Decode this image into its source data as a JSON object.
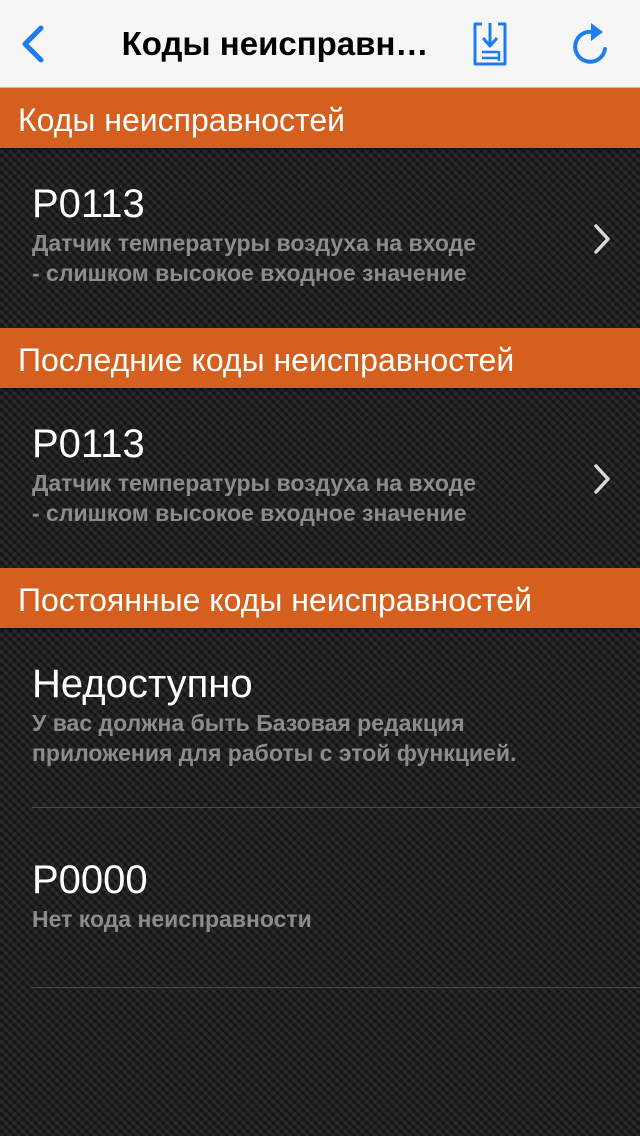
{
  "navbar": {
    "title": "Коды неисправн…",
    "back_icon": "chevron-left-icon",
    "export_icon": "export-document-icon",
    "refresh_icon": "refresh-icon",
    "accent_color": "#1e7cf2"
  },
  "theme": {
    "section_color": "#d45f1e",
    "code_color": "#ffffff",
    "desc_color": "#8c8c8c"
  },
  "sections": [
    {
      "title": "Коды неисправностей",
      "rows": [
        {
          "code": "P0113",
          "desc_line1": "Датчик температуры воздуха на входе",
          "desc_line2": "- слишком высокое входное значение",
          "has_chevron": true
        }
      ]
    },
    {
      "title": "Последние коды неисправностей",
      "rows": [
        {
          "code": "P0113",
          "desc_line1": "Датчик температуры воздуха на входе",
          "desc_line2": "- слишком высокое входное значение",
          "has_chevron": true
        }
      ]
    },
    {
      "title": "Постоянные коды неисправностей",
      "rows": [
        {
          "code": "Недоступно",
          "desc_line1": "У вас должна быть Базовая редакция",
          "desc_line2": "приложения для работы с этой функцией.",
          "has_chevron": false
        },
        {
          "code": "P0000",
          "desc_line1": "Нет кода неисправности",
          "has_chevron": false
        }
      ]
    }
  ]
}
